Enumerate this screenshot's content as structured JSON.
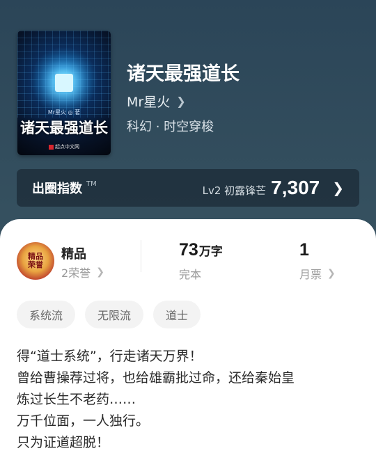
{
  "book": {
    "title": "诸天最强道长",
    "author": "Mr星火",
    "genre": "科幻 · 时空穿梭",
    "cover": {
      "author_line": "Mr星火 ◎ 著",
      "title": "诸天最强道长",
      "publisher": "起点中文网"
    }
  },
  "popularity": {
    "label": "出圈指数",
    "tm": "TM",
    "level": "Lv2 初露锋芒",
    "value": "7,307"
  },
  "stats": {
    "badge_text": "精品",
    "badge_icon_text": "精品\n荣誉",
    "quality_title": "精品",
    "honors": "2荣誉",
    "word_count_value": "73",
    "word_count_unit": "万字",
    "status": "完本",
    "monthly_votes_value": "1",
    "monthly_votes_label": "月票"
  },
  "tags": [
    "系统流",
    "无限流",
    "道士"
  ],
  "synopsis": [
    "得“道士系统”，行走诸天万界！",
    "曾给曹操荐过将，也给雄霸批过命，还给秦始皇",
    "炼过长生不老药……",
    "万千位面，一人独行。",
    "只为证道超脱！"
  ],
  "colors": {
    "header_bg": "#35505f",
    "card_bg": "#ffffff",
    "tag_bg": "#f3f3f3"
  }
}
